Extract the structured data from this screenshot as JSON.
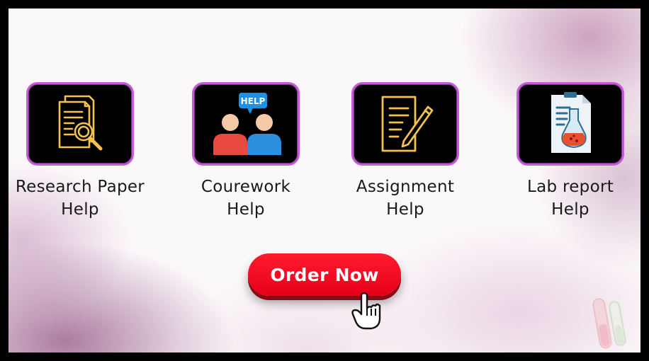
{
  "services": [
    {
      "line1": "Research Paper",
      "line2": "Help",
      "icon": "research-document-magnifier-icon"
    },
    {
      "line1": "Courework",
      "line2": "Help",
      "icon": "help-chat-people-icon",
      "badge": "HELP"
    },
    {
      "line1": "Assignment",
      "line2": "Help",
      "icon": "assignment-pencil-icon"
    },
    {
      "line1": "Lab report",
      "line2": "Help",
      "icon": "lab-report-flask-icon"
    }
  ],
  "cta": {
    "label": "Order Now"
  },
  "colors": {
    "tile_bg": "#000000",
    "tile_border": "#c55bd8",
    "button": "#ff1b2d",
    "icon_gold": "#f2c14e"
  }
}
